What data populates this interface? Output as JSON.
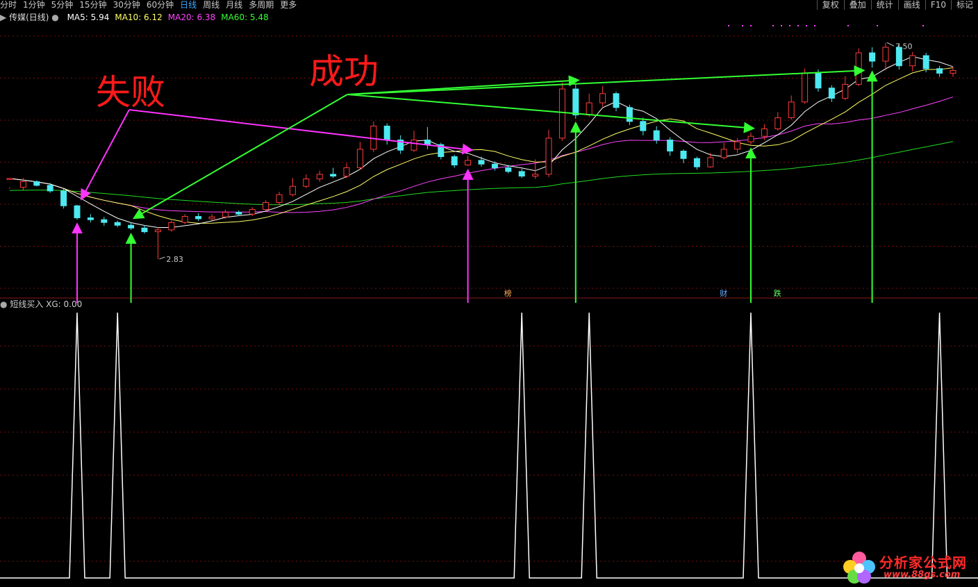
{
  "toolbar": {
    "periods": [
      {
        "label": "分时",
        "active": false
      },
      {
        "label": "1分钟",
        "active": false
      },
      {
        "label": "5分钟",
        "active": false
      },
      {
        "label": "15分钟",
        "active": false
      },
      {
        "label": "30分钟",
        "active": false
      },
      {
        "label": "60分钟",
        "active": false
      },
      {
        "label": "日线",
        "active": true
      },
      {
        "label": "周线",
        "active": false
      },
      {
        "label": "月线",
        "active": false
      },
      {
        "label": "多周期",
        "active": false
      },
      {
        "label": "更多",
        "active": false
      }
    ],
    "tools": [
      "复权",
      "叠加",
      "统计",
      "画线",
      "F10",
      "标记"
    ]
  },
  "legend": {
    "title": "传媒(日线)",
    "ma": [
      {
        "label": "MA5: 5.94",
        "color": "#ffffff"
      },
      {
        "label": "MA10: 6.12",
        "color": "#ffff66"
      },
      {
        "label": "MA20: 6.38",
        "color": "#ff44ff"
      },
      {
        "label": "MA60: 5.48",
        "color": "#33ff33"
      }
    ]
  },
  "indicator": {
    "label": "短线买入",
    "value": "XG: 0.00"
  },
  "annotations": {
    "fail": "失败",
    "success": "成功",
    "high": "7.50",
    "low": "2.83",
    "markers": [
      {
        "text": "榜",
        "color": "#ffaa55",
        "n": 37
      },
      {
        "text": "财",
        "color": "#66aaff",
        "n": 53
      },
      {
        "text": "跌",
        "color": "#66ff66",
        "n": 57
      }
    ]
  },
  "logo": {
    "name": "分析家公式网",
    "url": "www.88gs.com"
  },
  "colors": {
    "up": "#ff3b3b",
    "down": "#4de8f0",
    "ma5": "#ffffff",
    "ma10": "#ffff66",
    "ma20": "#ff44ff",
    "ma60": "#22dd22",
    "arrow_success": "#33ff33",
    "arrow_fail": "#ff33ff"
  },
  "chart_data": [
    {
      "type": "candlestick",
      "y_range": [
        2.2,
        8.0
      ],
      "candles": [
        [
          4.55,
          4.57,
          4.38,
          4.35
        ],
        [
          4.38,
          4.5,
          4.58,
          4.32
        ],
        [
          4.5,
          4.42,
          4.53,
          4.4
        ],
        [
          4.42,
          4.3,
          4.47,
          4.26
        ],
        [
          4.3,
          3.98,
          4.35,
          3.92
        ],
        [
          3.98,
          3.72,
          4.0,
          3.68
        ],
        [
          3.72,
          3.68,
          3.8,
          3.62
        ],
        [
          3.68,
          3.62,
          3.74,
          3.55
        ],
        [
          3.62,
          3.56,
          3.66,
          3.52
        ],
        [
          3.56,
          3.5,
          3.62,
          3.46
        ],
        [
          3.5,
          3.42,
          3.56,
          3.38
        ],
        [
          3.42,
          3.46,
          3.52,
          2.83
        ],
        [
          3.46,
          3.62,
          3.66,
          3.42
        ],
        [
          3.62,
          3.75,
          3.8,
          3.58
        ],
        [
          3.75,
          3.7,
          3.82,
          3.65
        ],
        [
          3.7,
          3.74,
          3.8,
          3.66
        ],
        [
          3.74,
          3.84,
          3.9,
          3.7
        ],
        [
          3.84,
          3.8,
          3.88,
          3.76
        ],
        [
          3.8,
          3.9,
          3.95,
          3.76
        ],
        [
          3.9,
          4.05,
          4.1,
          3.86
        ],
        [
          4.05,
          4.22,
          4.28,
          4.0
        ],
        [
          4.22,
          4.4,
          4.58,
          4.18
        ],
        [
          4.4,
          4.56,
          4.66,
          4.36
        ],
        [
          4.56,
          4.66,
          4.74,
          4.5
        ],
        [
          4.66,
          4.62,
          4.8,
          4.58
        ],
        [
          4.62,
          4.8,
          4.9,
          4.58
        ],
        [
          4.8,
          5.2,
          5.36,
          4.76
        ],
        [
          5.2,
          5.7,
          5.8,
          5.14
        ],
        [
          5.7,
          5.4,
          5.76,
          5.3
        ],
        [
          5.4,
          5.18,
          5.5,
          5.1
        ],
        [
          5.18,
          5.4,
          5.6,
          5.14
        ],
        [
          5.4,
          5.3,
          5.68,
          5.2
        ],
        [
          5.3,
          5.04,
          5.34,
          4.98
        ],
        [
          5.04,
          4.86,
          5.08,
          4.8
        ],
        [
          4.86,
          4.96,
          5.06,
          4.84
        ],
        [
          4.96,
          4.88,
          5.04,
          4.82
        ],
        [
          4.88,
          4.8,
          4.94,
          4.74
        ],
        [
          4.8,
          4.72,
          4.86,
          4.68
        ],
        [
          4.72,
          4.62,
          4.78,
          4.58
        ],
        [
          4.62,
          4.66,
          4.98,
          4.56
        ],
        [
          4.66,
          5.44,
          5.62,
          4.6
        ],
        [
          5.44,
          6.5,
          6.64,
          5.38
        ],
        [
          6.5,
          5.94,
          6.6,
          5.86
        ],
        [
          5.94,
          6.2,
          6.4,
          5.9
        ],
        [
          6.2,
          6.4,
          6.56,
          6.12
        ],
        [
          6.4,
          6.1,
          6.44,
          6.02
        ],
        [
          6.1,
          5.8,
          6.16,
          5.72
        ],
        [
          5.8,
          5.6,
          5.88,
          5.5
        ],
        [
          5.6,
          5.4,
          5.7,
          5.32
        ],
        [
          5.4,
          5.16,
          5.46,
          5.06
        ],
        [
          5.16,
          5.0,
          5.2,
          4.9
        ],
        [
          5.0,
          4.82,
          5.04,
          4.76
        ],
        [
          4.82,
          5.02,
          5.12,
          4.8
        ],
        [
          5.02,
          5.2,
          5.34,
          4.98
        ],
        [
          5.2,
          5.36,
          5.44,
          5.12
        ],
        [
          5.36,
          5.48,
          5.56,
          5.3
        ],
        [
          5.48,
          5.64,
          5.74,
          5.4
        ],
        [
          5.64,
          5.88,
          6.0,
          5.6
        ],
        [
          5.88,
          6.22,
          6.36,
          5.84
        ],
        [
          6.22,
          6.84,
          6.94,
          6.18
        ],
        [
          6.84,
          6.52,
          6.92,
          6.44
        ],
        [
          6.52,
          6.3,
          6.58,
          6.22
        ],
        [
          6.3,
          6.6,
          6.78,
          6.26
        ],
        [
          6.6,
          7.28,
          7.38,
          6.56
        ],
        [
          7.28,
          7.1,
          7.4,
          6.96
        ],
        [
          7.1,
          7.4,
          7.5,
          6.9
        ],
        [
          7.4,
          7.0,
          7.46,
          6.92
        ],
        [
          7.0,
          7.22,
          7.3,
          6.88
        ],
        [
          7.22,
          6.94,
          7.28,
          6.86
        ],
        [
          6.94,
          6.84,
          7.0,
          6.76
        ],
        [
          6.84,
          6.9,
          6.98,
          6.76
        ]
      ],
      "ma_final": {
        "MA5": 5.94,
        "MA10": 6.12,
        "MA20": 6.38,
        "MA60": 5.48
      }
    },
    {
      "type": "line",
      "name": "XG",
      "x": [
        0,
        1,
        2,
        3,
        4,
        5,
        6,
        7,
        8,
        9,
        10,
        11,
        12,
        13,
        14,
        15,
        16,
        17,
        18,
        19,
        20,
        21,
        22,
        23,
        24,
        25,
        26,
        27,
        28,
        29,
        30,
        31,
        32,
        33,
        34,
        35,
        36,
        37,
        38,
        39,
        40,
        41,
        42,
        43,
        44,
        45,
        46,
        47,
        48,
        49,
        50,
        51,
        52,
        53,
        54,
        55,
        56,
        57,
        58,
        59,
        60,
        61,
        62,
        63,
        64,
        65,
        66,
        67,
        68,
        69,
        70
      ],
      "values": [
        0,
        0,
        0,
        0,
        0,
        1,
        0,
        0,
        1,
        0,
        0,
        0,
        0,
        0,
        0,
        0,
        0,
        0,
        0,
        0,
        0,
        0,
        0,
        0,
        0,
        0,
        0,
        0,
        0,
        0,
        0,
        0,
        0,
        0,
        0,
        0,
        0,
        0,
        1,
        0,
        0,
        0,
        0,
        1,
        0,
        0,
        0,
        0,
        0,
        0,
        0,
        0,
        0,
        0,
        0,
        1,
        0,
        0,
        0,
        0,
        0,
        0,
        0,
        0,
        0,
        0,
        0,
        0,
        0,
        1,
        0
      ],
      "y_range": [
        0,
        1
      ]
    }
  ],
  "arrows": {
    "fail_from": "fail",
    "fail_targets": [
      5,
      34
    ],
    "success_from": "success",
    "success_targets": [
      9,
      42,
      55,
      64
    ],
    "signal_up_green": [
      9,
      42,
      55,
      64
    ],
    "signal_up_pink": [
      5,
      34
    ]
  }
}
